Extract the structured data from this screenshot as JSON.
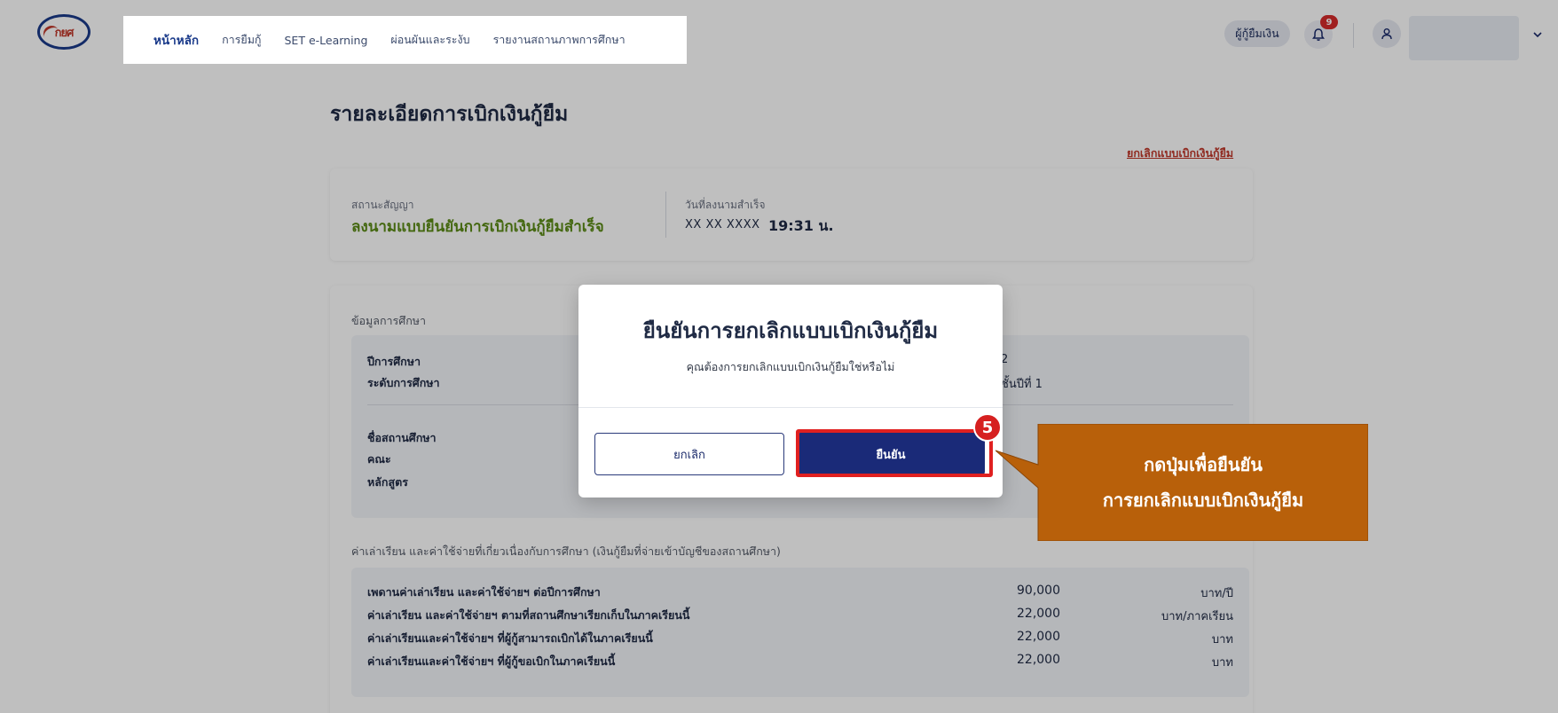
{
  "nav": {
    "logo_text": "กยศ",
    "items": [
      "หน้าหลัก",
      "การยืมกู้",
      "SET e-Learning",
      "ผ่อนผันและระงับ",
      "รายงานสถานภาพการศึกษา"
    ]
  },
  "header": {
    "role": "ผู้กู้ยืมเงิน",
    "notification_count": "9",
    "icons": [
      "bell-icon",
      "user-icon",
      "chevron-down-icon"
    ]
  },
  "page": {
    "title": "รายละเอียดการเบิกเงินกู้ยืม",
    "cancel_link": "ยกเลิกแบบเบิกเงินกู้ยืม"
  },
  "status": {
    "contract_label": "สถานะสัญญา",
    "contract_value": "ลงนามแบบยืนยันการเบิกเงินกู้ยืมสำเร็จ",
    "signed_label": "วันที่ลงนามสำเร็จ",
    "signed_date": "XX XX XXXX",
    "signed_time": "19:31 น."
  },
  "education": {
    "section_label": "ข้อมูลการศึกษา",
    "rows": [
      {
        "label": "ปีการศึกษา",
        "value": "2"
      },
      {
        "label": "ระดับการศึกษา",
        "value": "ชั้นปีที่ 1"
      },
      {
        "label": "ชื่อสถานศึกษา",
        "value": ""
      },
      {
        "label": "คณะ",
        "value": ""
      },
      {
        "label": "หลักสูตร",
        "value": ""
      }
    ]
  },
  "fees": {
    "section_label": "ค่าเล่าเรียน และค่าใช้จ่ายที่เกี่ยวเนื่องกับการศึกษา (เงินกู้ยืมที่จ่ายเข้าบัญชีของสถานศึกษา)",
    "rows": [
      {
        "label": "เพดานค่าเล่าเรียน และค่าใช้จ่ายฯ ต่อปีการศึกษา",
        "amount": "90,000",
        "unit": "บาท/ปี"
      },
      {
        "label": "ค่าเล่าเรียน และค่าใช้จ่ายฯ ตามที่สถานศึกษาเรียกเก็บในภาคเรียนนี้",
        "amount": "22,000",
        "unit": "บาท/ภาคเรียน"
      },
      {
        "label": "ค่าเล่าเรียนและค่าใช้จ่ายฯ ที่ผู้กู้สามารถเบิกได้ในภาคเรียนนี้",
        "amount": "22,000",
        "unit": "บาท"
      },
      {
        "label": "ค่าเล่าเรียนและค่าใช้จ่ายฯ ที่ผู้กู้ขอเบิกในภาคเรียนนี้",
        "amount": "22,000",
        "unit": "บาท"
      }
    ]
  },
  "modal": {
    "title": "ยืนยันการยกเลิกแบบเบิกเงินกู้ยืม",
    "message": "คุณต้องการยกเลิกแบบเบิกเงินกู้ยืมใช่หรือไม่",
    "cancel_label": "ยกเลิก",
    "confirm_label": "ยืนยัน"
  },
  "annotation": {
    "step_number": "5",
    "callout_line1": "กดปุ่มเพื่อยืนยัน",
    "callout_line2": "การยกเลิกแบบเบิกเงินกู้ยืม"
  },
  "colors": {
    "brand": "#1a2a78",
    "status_success": "#5a8a14",
    "danger": "#d62020",
    "callout": "#b8600a"
  }
}
